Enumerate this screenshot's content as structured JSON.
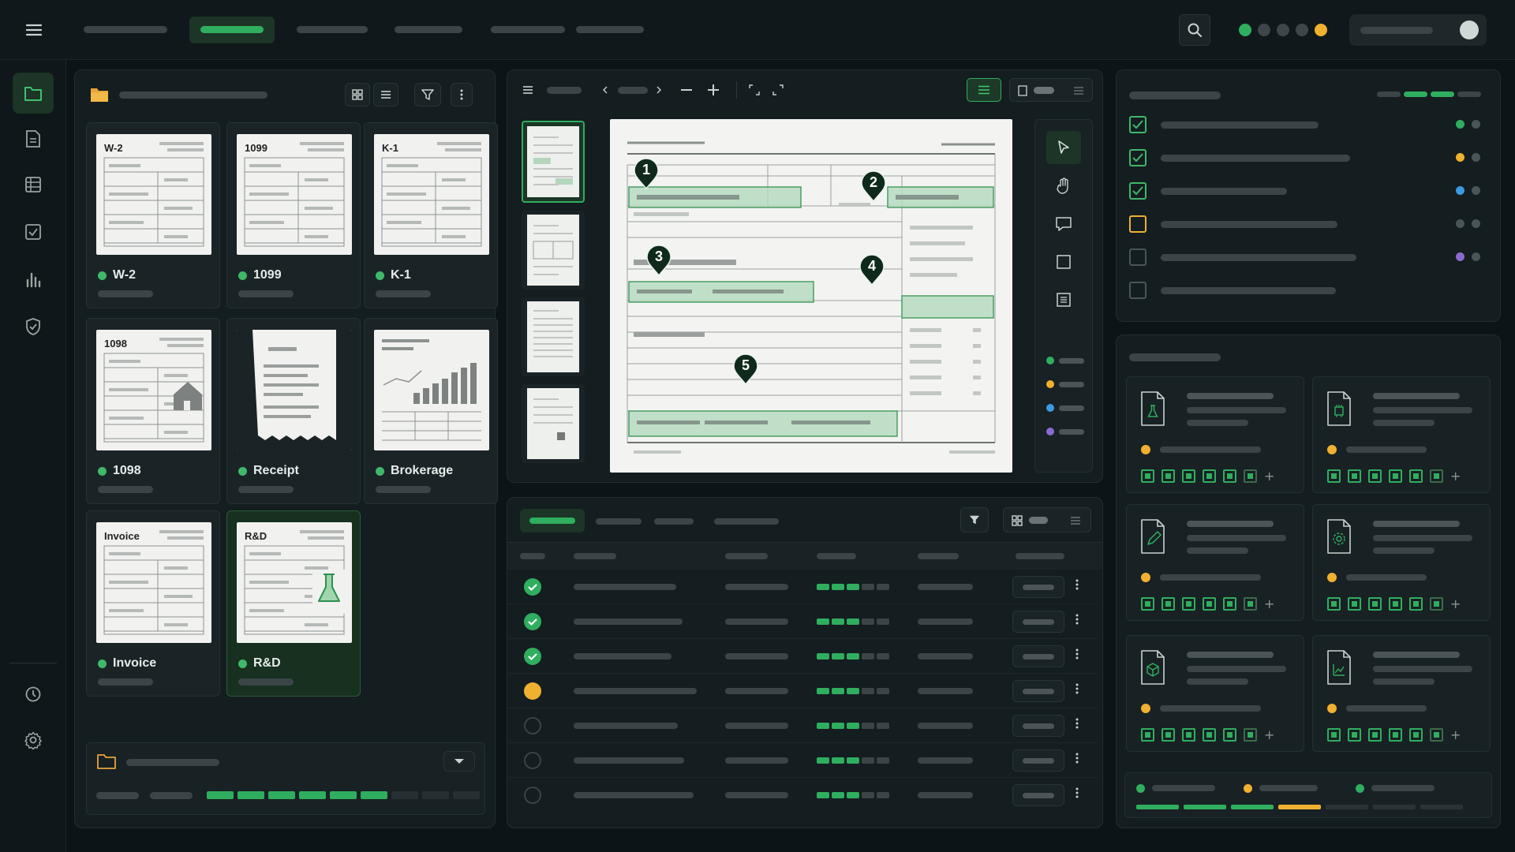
{
  "documents": [
    {
      "thumb_title": "W-2",
      "label": "W-2",
      "type": "form"
    },
    {
      "thumb_title": "1099",
      "label": "1099",
      "type": "form"
    },
    {
      "thumb_title": "K-1",
      "label": "K-1",
      "type": "form"
    },
    {
      "thumb_title": "1098",
      "label": "1098",
      "type": "house"
    },
    {
      "thumb_title": "",
      "label": "Receipt",
      "type": "receipt"
    },
    {
      "thumb_title": "",
      "label": "Brokerage",
      "type": "chart"
    },
    {
      "thumb_title": "Invoice",
      "label": "Invoice",
      "type": "form"
    },
    {
      "thumb_title": "R&D",
      "label": "R&D",
      "type": "flask"
    }
  ],
  "editor": {
    "pins": [
      "1",
      "2",
      "3",
      "4",
      "5"
    ]
  },
  "colors": {
    "accent": "#2fae5f",
    "warning": "#f0b030",
    "info": "#3b9ae0",
    "purple": "#8a6ad0",
    "neutral": "#4a5558"
  },
  "status_dots": [
    "green",
    "gray",
    "gray",
    "gray",
    "amber"
  ]
}
